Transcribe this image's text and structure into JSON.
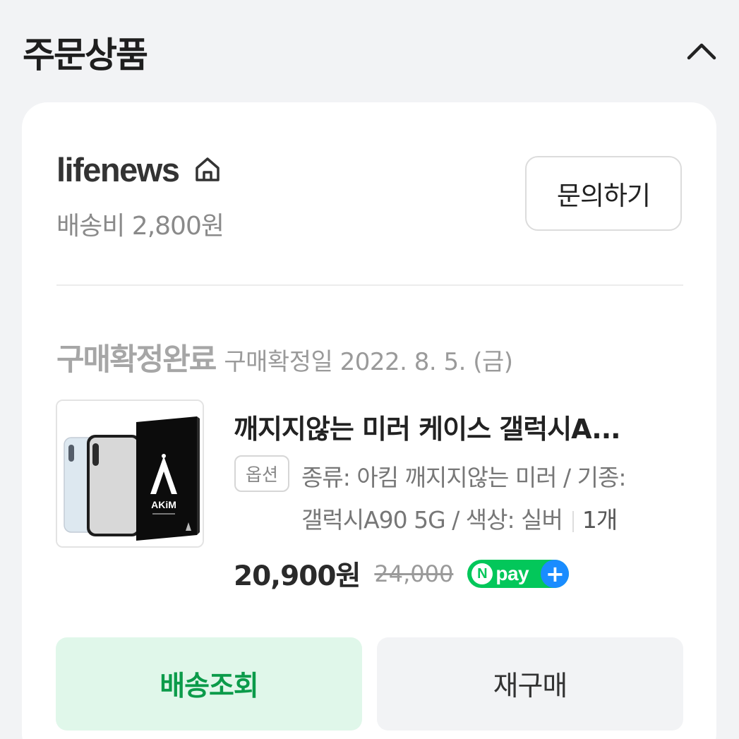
{
  "section": {
    "title": "주문상품"
  },
  "seller": {
    "name": "lifenews",
    "shipping_fee": "배송비 2,800원",
    "inquiry_label": "문의하기"
  },
  "order": {
    "status": "구매확정완료",
    "confirm_date": "구매확정일 2022. 8. 5. (금)"
  },
  "product": {
    "name": "깨지지않는 미러 케이스 갤럭시A...",
    "option_badge": "옵션",
    "option_line1": "종류: 아킴 깨지지않는 미러 / 기종:",
    "option_line2": "갤럭시A90 5G / 색상: 실버",
    "quantity": "1개",
    "price": "20,900원",
    "original_price": "24,000",
    "npay_label": "pay",
    "image_brand": "AKiM"
  },
  "actions": {
    "track_label": "배송조회",
    "rebuy_label": "재구매"
  },
  "colors": {
    "accent_green": "#03c75a",
    "track_text": "#0b9b4a",
    "track_bg": "#e0f7ea",
    "npay_plus": "#1a8cff"
  }
}
